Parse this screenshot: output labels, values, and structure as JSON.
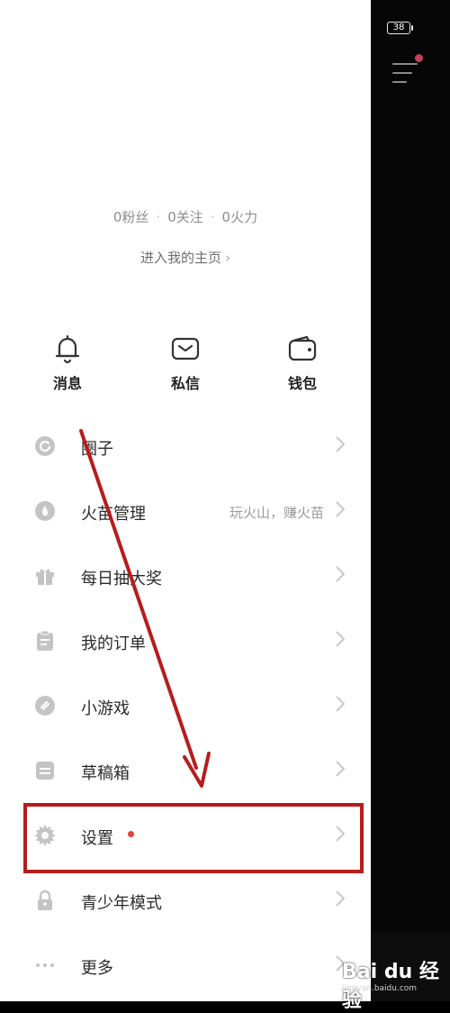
{
  "statusbar": {
    "battery": "38"
  },
  "profile": {
    "fans": "0粉丝",
    "following": "0关注",
    "fire": "0火力",
    "separator": "·",
    "home_link": "进入我的主页",
    "home_chevron": "›"
  },
  "quick_actions": [
    {
      "label": "消息",
      "icon": "bell-icon"
    },
    {
      "label": "私信",
      "icon": "envelope-icon"
    },
    {
      "label": "钱包",
      "icon": "wallet-icon"
    }
  ],
  "menu": [
    {
      "label": "圈子",
      "icon": "circle-icon",
      "hint": ""
    },
    {
      "label": "火苗管理",
      "icon": "flame-icon",
      "hint": "玩火山，赚火苗"
    },
    {
      "label": "每日抽大奖",
      "icon": "gift-icon",
      "hint": ""
    },
    {
      "label": "我的订单",
      "icon": "clipboard-icon",
      "hint": ""
    },
    {
      "label": "小游戏",
      "icon": "game-link-icon",
      "hint": ""
    },
    {
      "label": "草稿箱",
      "icon": "drafts-icon",
      "hint": ""
    },
    {
      "label": "设置",
      "icon": "gear-icon",
      "hint": ""
    },
    {
      "label": "青少年模式",
      "icon": "lock-icon",
      "hint": ""
    },
    {
      "label": "更多",
      "icon": "more-dots-icon",
      "hint": ""
    }
  ],
  "watermark": {
    "main": "Bai du 经验",
    "sub": "jingyan.baidu.com"
  },
  "colors": {
    "annotation_red": "#b71c1c",
    "badge_red": "#e64338",
    "icon_gray": "#c4c4c4"
  }
}
